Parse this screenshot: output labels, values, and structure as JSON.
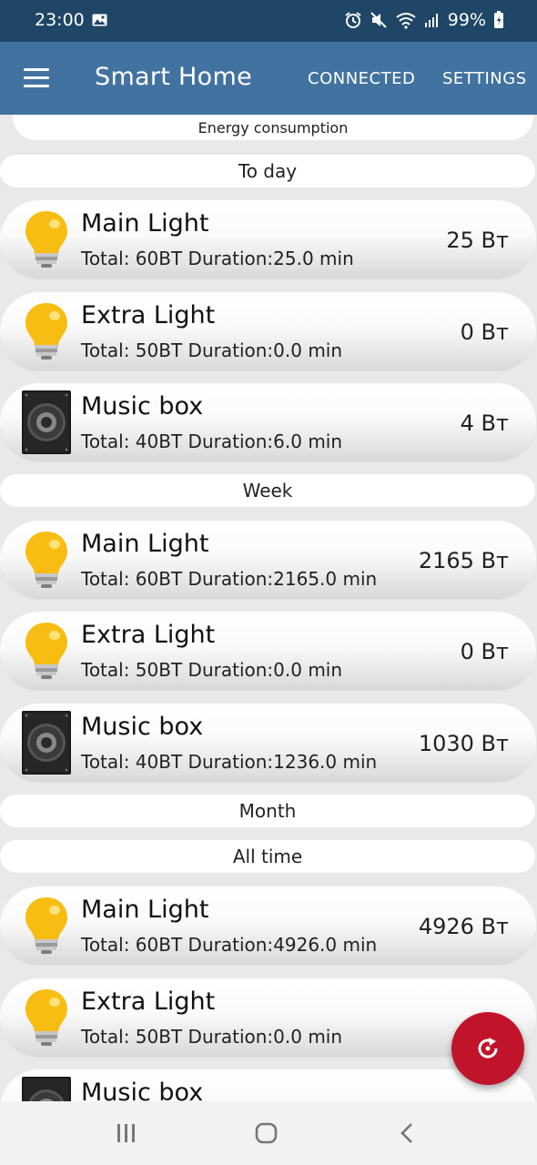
{
  "status": {
    "time": "23:00",
    "battery": "99%"
  },
  "app_bar": {
    "title": "Smart Home",
    "connected_label": "CONNECTED",
    "settings_label": "SETTINGS"
  },
  "header_title": "Energy consumption",
  "sections": {
    "today": {
      "label": "To day",
      "items": [
        {
          "name": "Main Light",
          "detail": "Total: 60BT Duration:25.0 min",
          "power": "25 Вт",
          "icon": "bulb-icon"
        },
        {
          "name": "Extra Light",
          "detail": "Total: 50BT Duration:0.0 min",
          "power": "0 Вт",
          "icon": "bulb-icon"
        },
        {
          "name": "Music box",
          "detail": "Total: 40BT Duration:6.0 min",
          "power": "4 Вт",
          "icon": "speaker-icon"
        }
      ]
    },
    "week": {
      "label": "Week",
      "items": [
        {
          "name": "Main Light",
          "detail": "Total: 60BT Duration:2165.0 min",
          "power": "2165 Вт",
          "icon": "bulb-icon"
        },
        {
          "name": "Extra Light",
          "detail": "Total: 50BT Duration:0.0 min",
          "power": "0 Вт",
          "icon": "bulb-icon"
        },
        {
          "name": "Music box",
          "detail": "Total: 40BT Duration:1236.0 min",
          "power": "1030 Вт",
          "icon": "speaker-icon"
        }
      ]
    },
    "month": {
      "label": "Month"
    },
    "all_time": {
      "label": "All time",
      "items": [
        {
          "name": "Main Light",
          "detail": "Total: 60BT Duration:4926.0 min",
          "power": "4926 Вт",
          "icon": "bulb-icon"
        },
        {
          "name": "Extra Light",
          "detail": "Total: 50BT Duration:0.0 min",
          "power": "",
          "icon": "bulb-icon"
        },
        {
          "name": "Music box",
          "detail": "",
          "power": "",
          "icon": "speaker-icon"
        }
      ]
    }
  },
  "fab": {
    "icon": "refresh-icon",
    "color": "#c0142a"
  },
  "colors": {
    "status_bar": "#1f4666",
    "app_bar": "#4272a0",
    "background": "#e9e9e9"
  }
}
